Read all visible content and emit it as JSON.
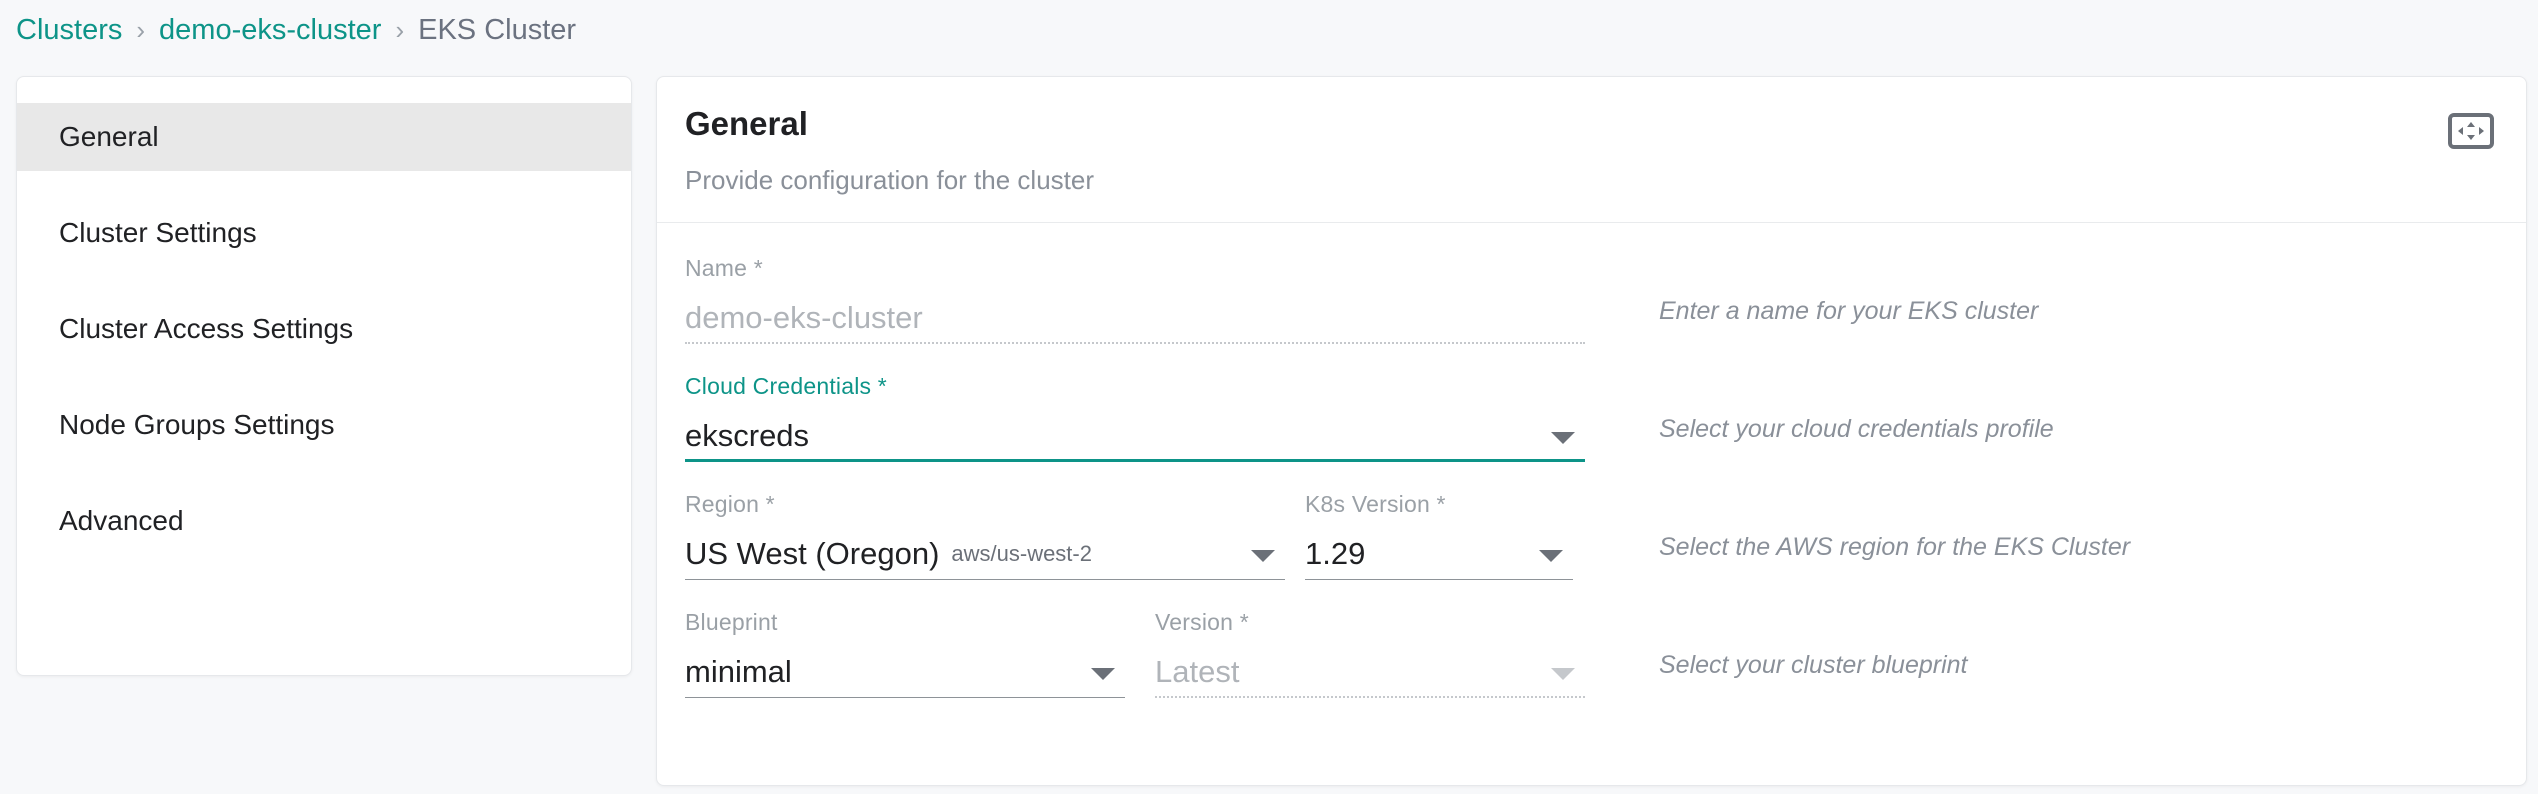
{
  "breadcrumb": {
    "items": [
      {
        "label": "Clusters",
        "type": "link"
      },
      {
        "label": "demo-eks-cluster",
        "type": "link"
      },
      {
        "label": "EKS Cluster",
        "type": "current"
      }
    ],
    "separator": "›"
  },
  "sidebar": {
    "items": [
      {
        "label": "General",
        "active": true
      },
      {
        "label": "Cluster Settings",
        "active": false
      },
      {
        "label": "Cluster Access Settings",
        "active": false
      },
      {
        "label": "Node Groups Settings",
        "active": false
      },
      {
        "label": "Advanced",
        "active": false
      }
    ]
  },
  "panel": {
    "title": "General",
    "subtitle": "Provide configuration for the cluster",
    "expand_icon": "fullscreen-expand-icon"
  },
  "fields": {
    "name": {
      "label": "Name *",
      "value": "demo-eks-cluster",
      "hint": "Enter a name for your EKS cluster"
    },
    "cloud_credentials": {
      "label": "Cloud Credentials *",
      "value": "ekscreds",
      "hint": "Select your cloud credentials profile"
    },
    "region": {
      "label": "Region *",
      "value": "US West (Oregon)",
      "sub_value": "aws/us-west-2",
      "hint": "Select the AWS region for the EKS Cluster"
    },
    "k8s_version": {
      "label": "K8s Version *",
      "value": "1.29"
    },
    "blueprint": {
      "label": "Blueprint",
      "value": "minimal",
      "hint": "Select your cluster blueprint"
    },
    "version": {
      "label": "Version *",
      "value": "Latest"
    }
  },
  "colors": {
    "accent": "#0d9488",
    "text": "#202124",
    "muted": "#8a9099",
    "page_bg": "#f7f8fa",
    "active_nav_bg": "#e8e8e8"
  }
}
